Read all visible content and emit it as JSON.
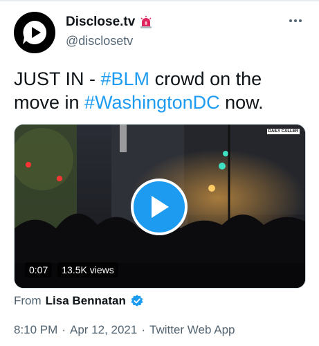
{
  "account": {
    "name": "Disclose.tv",
    "handle": "@disclosetv",
    "name_emoji_icon": "police-siren-icon"
  },
  "tweet": {
    "text_prefix": "JUST IN - ",
    "hashtag1": "#BLM",
    "text_middle": " crowd on the move in ",
    "hashtag2": "#WashingtonDC",
    "text_suffix": " now."
  },
  "video": {
    "duration": "0:07",
    "views": "13.5K views",
    "watermark": "DAILY CALLER"
  },
  "source": {
    "label": "From",
    "user": "Lisa Bennatan"
  },
  "meta": {
    "time": "8:10 PM",
    "date": "Apr 12, 2021",
    "app": "Twitter Web App",
    "separator": "·"
  },
  "colors": {
    "link": "#1d9bf0",
    "secondary_text": "#536471",
    "primary_text": "#0f1419"
  }
}
